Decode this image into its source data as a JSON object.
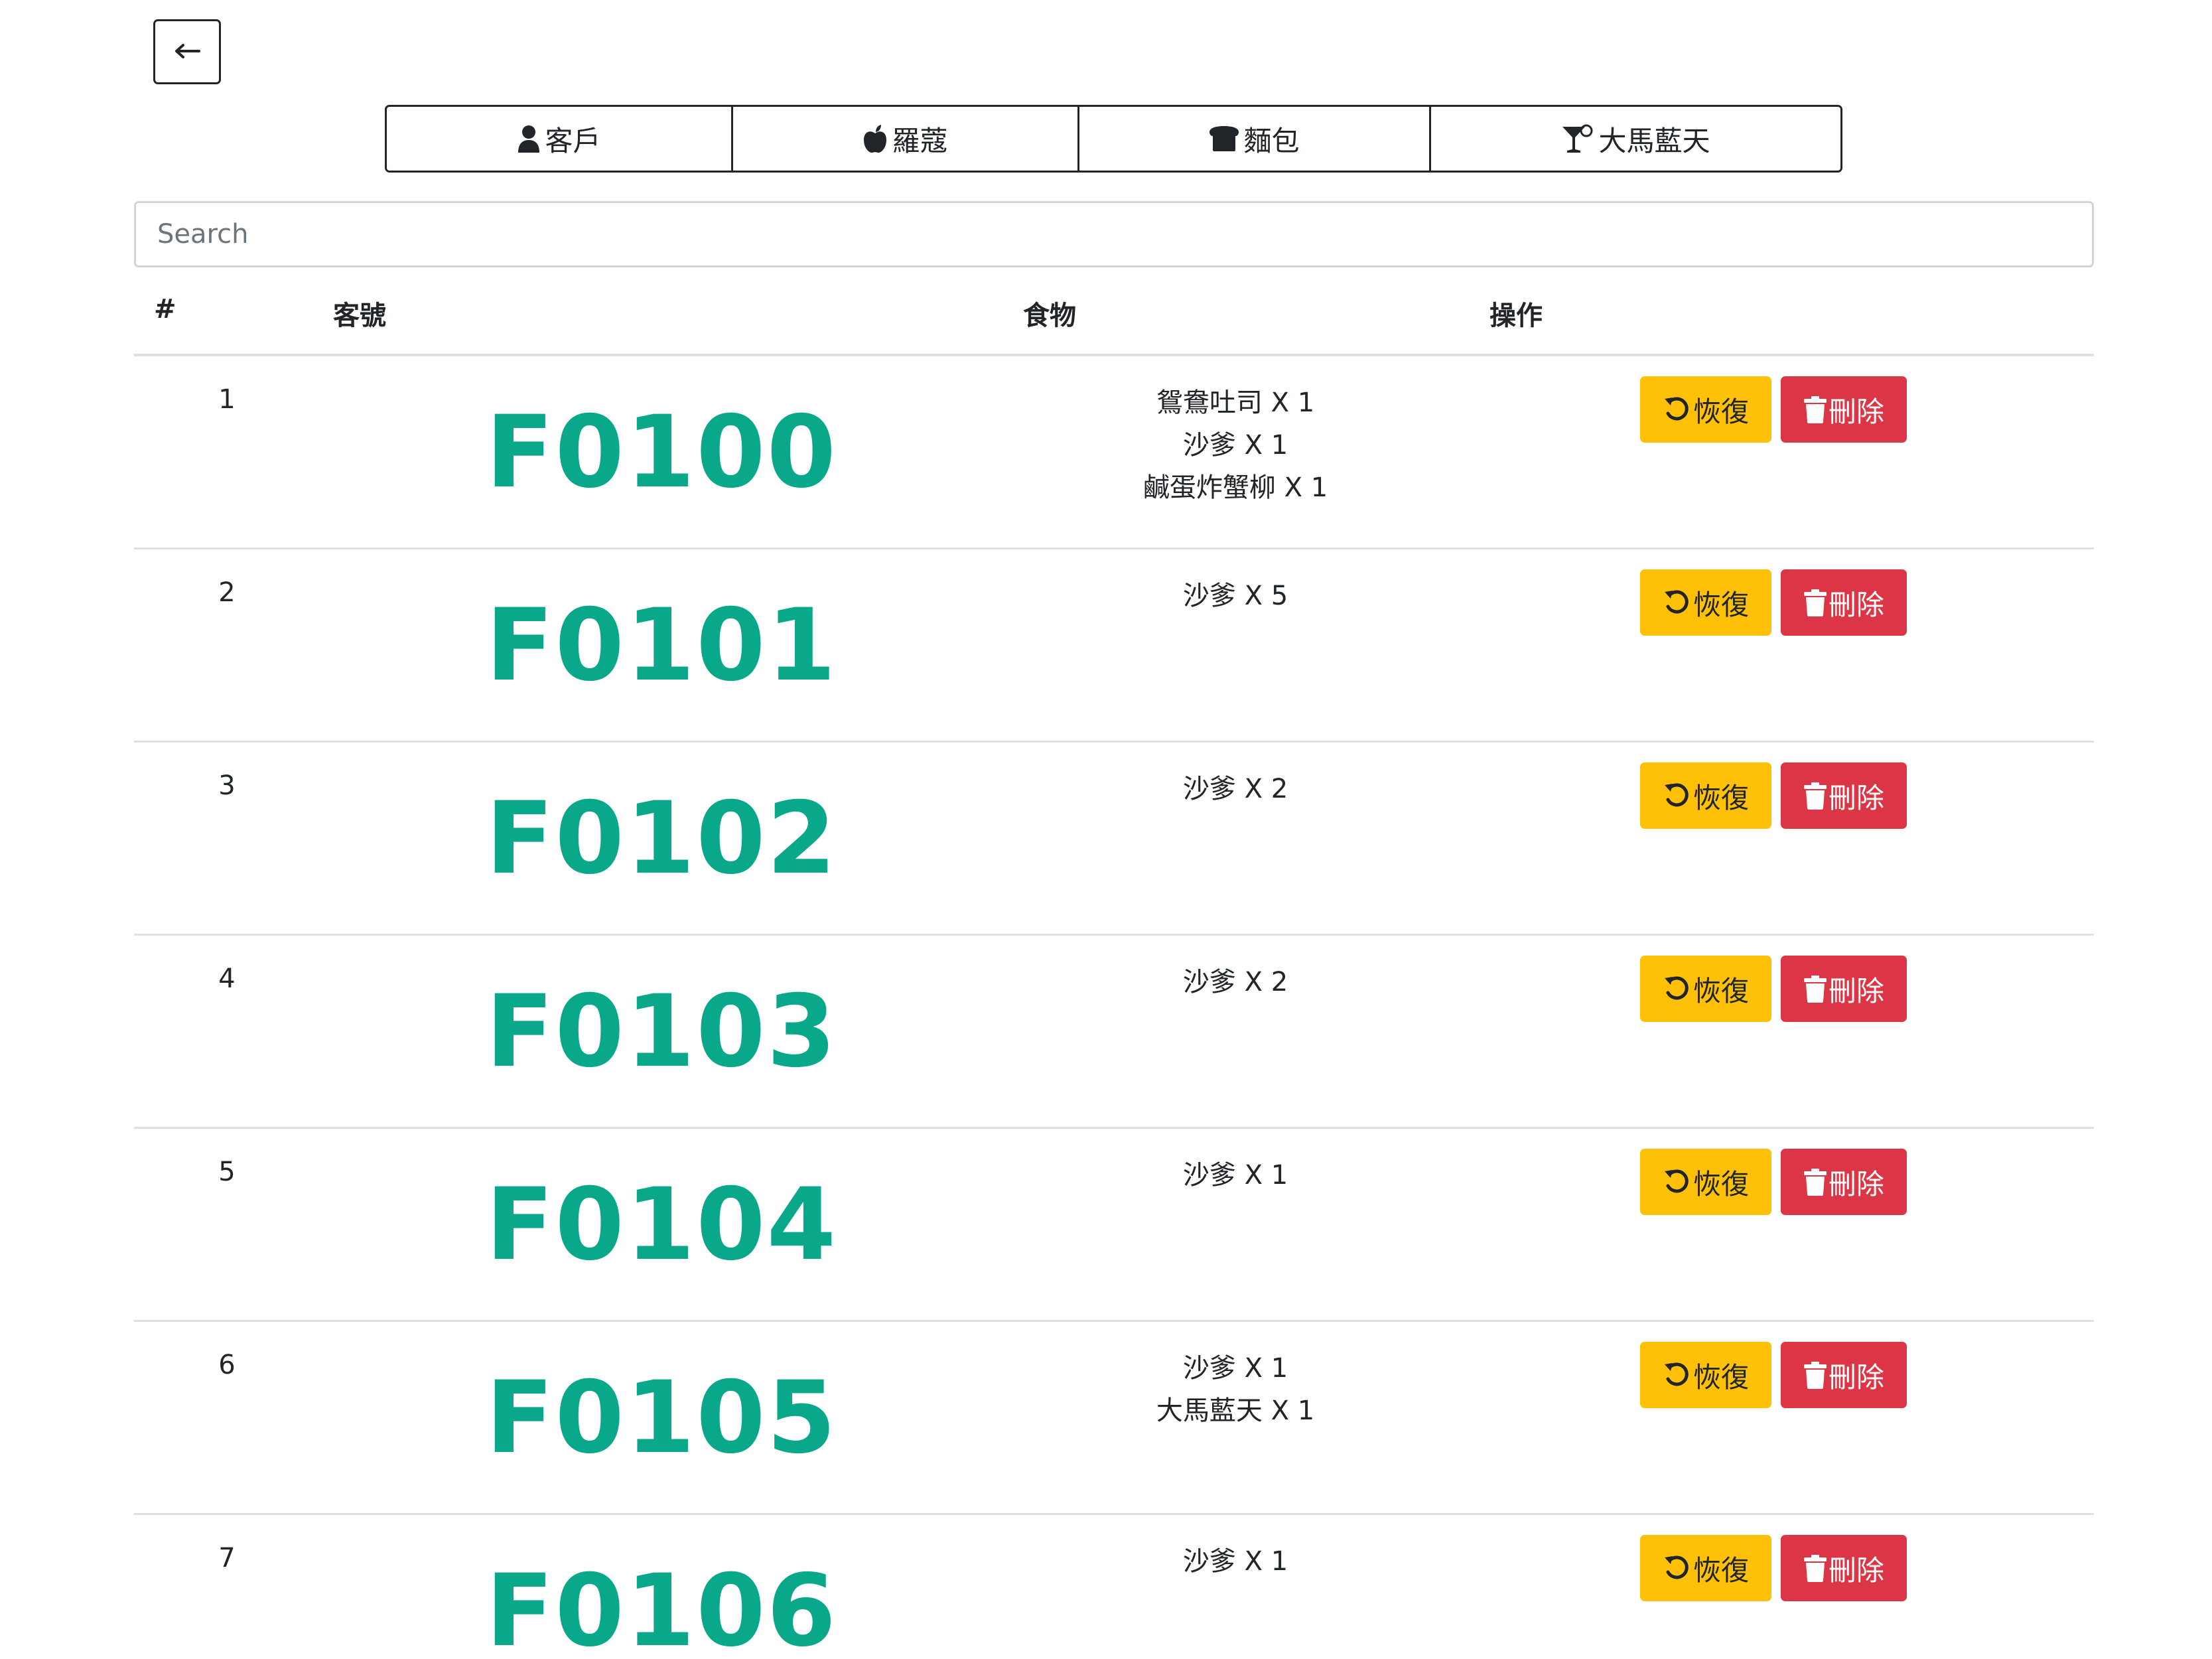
{
  "nav": {
    "back_icon": "arrow-left-icon"
  },
  "categories": [
    {
      "label": "客戶",
      "icon": "user-icon"
    },
    {
      "label": "羅蔻",
      "icon": "apple-icon"
    },
    {
      "label": "麵包",
      "icon": "bread-icon"
    },
    {
      "label": "大馬藍天",
      "icon": "cocktail-icon"
    }
  ],
  "search": {
    "placeholder": "Search",
    "value": ""
  },
  "table": {
    "headers": {
      "index": "#",
      "customer": "客號",
      "food": "食物",
      "actions": "操作"
    },
    "restore_label": "恢復",
    "delete_label": "刪除",
    "restore_icon": "undo-icon",
    "delete_icon": "trash-icon",
    "rows": [
      {
        "index": "1",
        "code": "F0100",
        "foods": [
          "鴛鴦吐司 X 1",
          "沙爹 X 1",
          "鹹蛋炸蟹柳 X 1"
        ]
      },
      {
        "index": "2",
        "code": "F0101",
        "foods": [
          "沙爹 X 5"
        ]
      },
      {
        "index": "3",
        "code": "F0102",
        "foods": [
          "沙爹 X 2"
        ]
      },
      {
        "index": "4",
        "code": "F0103",
        "foods": [
          "沙爹 X 2"
        ]
      },
      {
        "index": "5",
        "code": "F0104",
        "foods": [
          "沙爹 X 1"
        ]
      },
      {
        "index": "6",
        "code": "F0105",
        "foods": [
          "沙爹 X 1",
          "大馬藍天 X 1"
        ]
      },
      {
        "index": "7",
        "code": "F0106",
        "foods": [
          "沙爹 X 1"
        ]
      }
    ]
  },
  "colors": {
    "code_text": "#0aa88a",
    "restore_button": "#ffc107",
    "delete_button": "#dc3545"
  }
}
